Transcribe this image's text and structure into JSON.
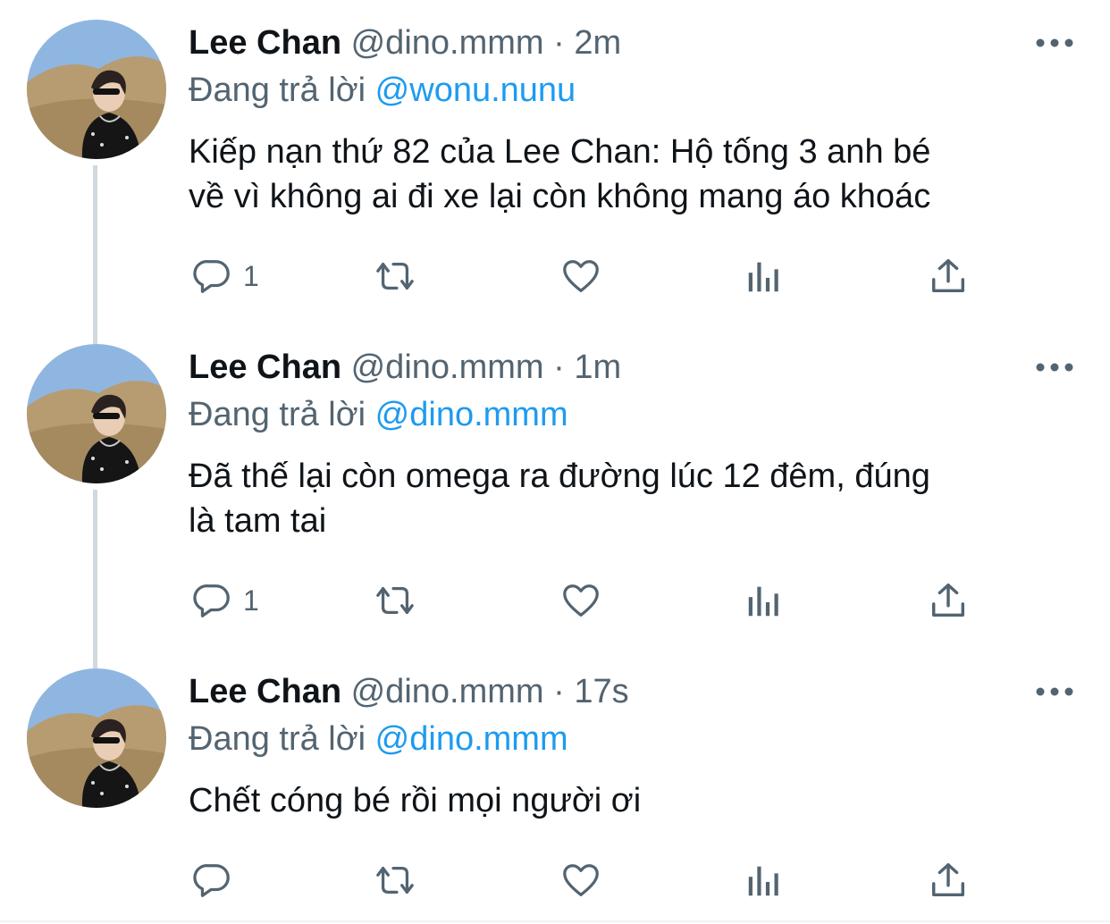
{
  "colors": {
    "text": "#0f1419",
    "secondary": "#536471",
    "accent": "#1d9bf0",
    "thread_line": "#cfd9de"
  },
  "tweets": [
    {
      "name": "Lee Chan",
      "handle": "@dino.mmm",
      "sep": "·",
      "time": "2m",
      "reply_prefix": "Đang trả lời",
      "reply_to": "@wonu.nunu",
      "lines": [
        "Kiếp nạn thứ 82 của Lee Chan: Hộ tống 3 anh bé",
        "về vì không ai đi xe lại còn không mang áo khoác"
      ],
      "reply_count": "1",
      "icons": [
        "reply-icon",
        "retweet-icon",
        "like-icon",
        "analytics-icon",
        "share-icon",
        "more-icon"
      ]
    },
    {
      "name": "Lee Chan",
      "handle": "@dino.mmm",
      "sep": "·",
      "time": "1m",
      "reply_prefix": "Đang trả lời",
      "reply_to": "@dino.mmm",
      "lines": [
        "Đã thế lại còn omega ra đường lúc 12 đêm, đúng",
        "là tam tai"
      ],
      "reply_count": "1",
      "icons": [
        "reply-icon",
        "retweet-icon",
        "like-icon",
        "analytics-icon",
        "share-icon",
        "more-icon"
      ]
    },
    {
      "name": "Lee Chan",
      "handle": "@dino.mmm",
      "sep": "·",
      "time": "17s",
      "reply_prefix": "Đang trả lời",
      "reply_to": "@dino.mmm",
      "lines": [
        "Chết cóng bé rồi mọi người ơi"
      ],
      "reply_count": "",
      "icons": [
        "reply-icon",
        "retweet-icon",
        "like-icon",
        "analytics-icon",
        "share-icon",
        "more-icon"
      ]
    }
  ]
}
